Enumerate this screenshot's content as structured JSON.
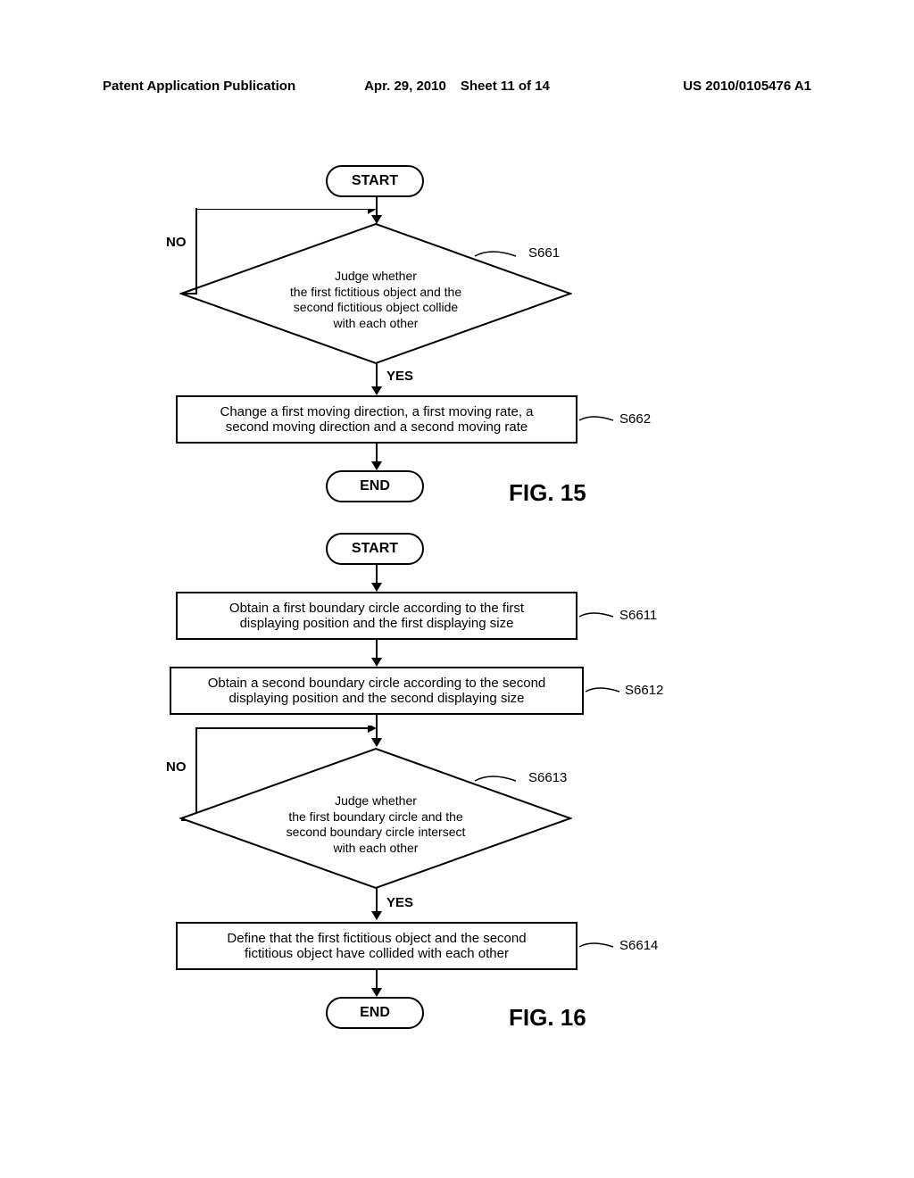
{
  "header": {
    "left": "Patent Application Publication",
    "date": "Apr. 29, 2010",
    "sheet": "Sheet 11 of 14",
    "right": "US 2010/0105476 A1"
  },
  "fig15": {
    "start": "START",
    "decision": "Judge whether\nthe first fictitious object and the\nsecond fictitious object collide\nwith each other",
    "no": "NO",
    "yes": "YES",
    "process": "Change a first moving direction, a first moving rate, a\nsecond moving direction and a second moving rate",
    "end": "END",
    "step1": "S661",
    "step2": "S662",
    "title": "FIG. 15"
  },
  "fig16": {
    "start": "START",
    "process1": "Obtain a first boundary circle according to the first\ndisplaying position and the first displaying size",
    "process2": "Obtain a second boundary circle according to the second\ndisplaying position and the second displaying size",
    "decision": "Judge whether\nthe first boundary circle and the\nsecond boundary circle intersect\nwith each other",
    "no": "NO",
    "yes": "YES",
    "process3": "Define that the first fictitious object and the second\nfictitious object have collided with each other",
    "end": "END",
    "step1": "S6611",
    "step2": "S6612",
    "step3": "S6613",
    "step4": "S6614",
    "title": "FIG. 16"
  }
}
